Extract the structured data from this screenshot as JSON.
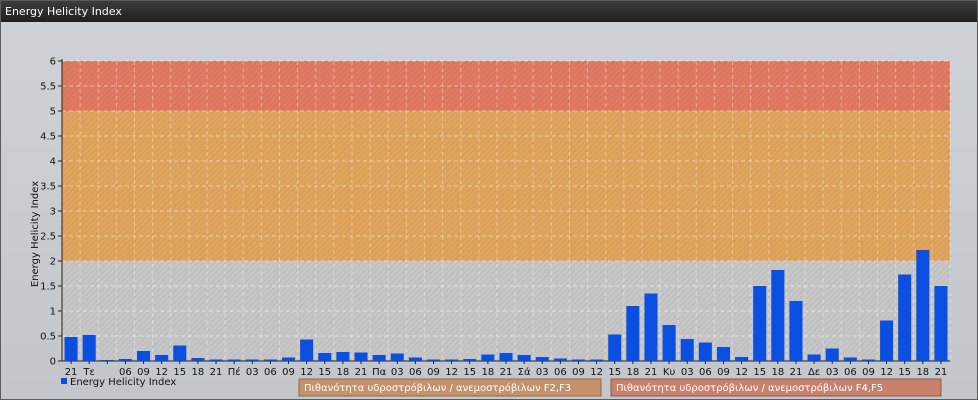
{
  "window": {
    "title": "Energy Helicity Index"
  },
  "colors": {
    "bar": "#0a4fe0",
    "band_low": "#c6c6c6",
    "band_mid": "#e0a45e",
    "band_high": "#e07a62",
    "legend_box_1": "#c4916a",
    "legend_box_2": "#c9806c"
  },
  "chart_data": {
    "type": "bar",
    "ylabel": "Energy Helicity Index",
    "ylim": [
      0,
      6
    ],
    "yticks": [
      "0",
      "0.5",
      "1",
      "1.5",
      "2",
      "2.5",
      "3",
      "3.5",
      "4",
      "4.5",
      "5",
      "5.5",
      "6"
    ],
    "categories": [
      "21",
      "Τε",
      "",
      "06",
      "09",
      "12",
      "15",
      "18",
      "21",
      "Πέ",
      "03",
      "06",
      "09",
      "12",
      "15",
      "18",
      "21",
      "Πα",
      "03",
      "06",
      "09",
      "12",
      "15",
      "18",
      "21",
      "Σά",
      "03",
      "06",
      "09",
      "12",
      "15",
      "18",
      "21",
      "Κυ",
      "03",
      "06",
      "09",
      "12",
      "15",
      "18",
      "21",
      "Δε",
      "03",
      "06",
      "09",
      "12",
      "15",
      "18",
      "21"
    ],
    "series": [
      {
        "name": "Energy Helicity Index",
        "values": [
          0.48,
          0.52,
          0.02,
          0.04,
          0.2,
          0.12,
          0.31,
          0.06,
          0.03,
          0.03,
          0.03,
          0.03,
          0.07,
          0.43,
          0.16,
          0.18,
          0.17,
          0.12,
          0.15,
          0.07,
          0.03,
          0.03,
          0.04,
          0.13,
          0.16,
          0.12,
          0.08,
          0.05,
          0.03,
          0.03,
          0.53,
          1.1,
          1.35,
          0.72,
          0.44,
          0.37,
          0.28,
          0.08,
          1.5,
          1.82,
          1.2,
          0.13,
          0.25,
          0.07,
          0.03,
          0.81,
          1.73,
          2.22,
          1.5
        ]
      }
    ],
    "threshold_bands": [
      {
        "from": 0,
        "to": 2,
        "level": "low"
      },
      {
        "from": 2,
        "to": 5,
        "level": "mid",
        "label": "Πιθανότητα υδροστρόβιλων / ανεμοστρόβιλων F2,F3"
      },
      {
        "from": 5,
        "to": 6,
        "level": "high",
        "label": "Πιθανότητα υδροστρόβιλων / ανεμοστρόβιλων F4,F5"
      }
    ],
    "grid": true,
    "legend": "bottom-left"
  }
}
